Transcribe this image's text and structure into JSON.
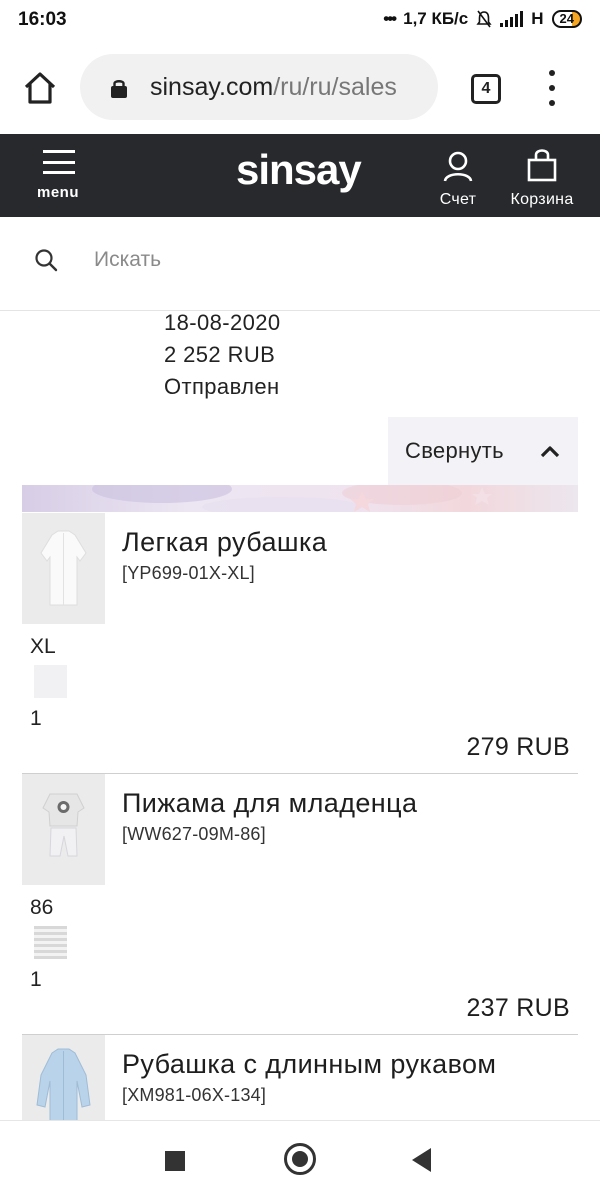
{
  "status_bar": {
    "time": "16:03",
    "network_speed": "1,7 КБ/с",
    "network_type": "H",
    "battery": "24"
  },
  "browser": {
    "url_domain": "sinsay.com",
    "url_path": "/ru/ru/sales",
    "tab_count": "4"
  },
  "site_header": {
    "menu_label": "menu",
    "logo": "sinsay",
    "account_label": "Счет",
    "cart_label": "Корзина",
    "bg_color": "#27292c"
  },
  "search": {
    "placeholder": "Искать"
  },
  "order": {
    "date": "18-08-2020",
    "total": "2 252 RUB",
    "status": "Отправлен",
    "collapse_label": "Свернуть"
  },
  "items": [
    {
      "name": "Легкая рубашка",
      "sku": "[YP699-01X-XL]",
      "size": "XL",
      "quantity": "1",
      "price": "279 RUB"
    },
    {
      "name": "Пижама для младенца",
      "sku": "[WW627-09M-86]",
      "size": "86",
      "quantity": "1",
      "price": "237 RUB"
    },
    {
      "name": "Рубашка с длинным рукавом",
      "sku": "[XM981-06X-134]"
    }
  ],
  "icons": {
    "home": "home-icon",
    "lock": "lock-icon",
    "tabs": "tabs-icon",
    "more": "more-vert-icon",
    "menu": "hamburger-icon",
    "account": "user-icon",
    "cart": "shopping-bag-icon",
    "search": "search-icon",
    "collapse": "chevron-up-icon"
  }
}
